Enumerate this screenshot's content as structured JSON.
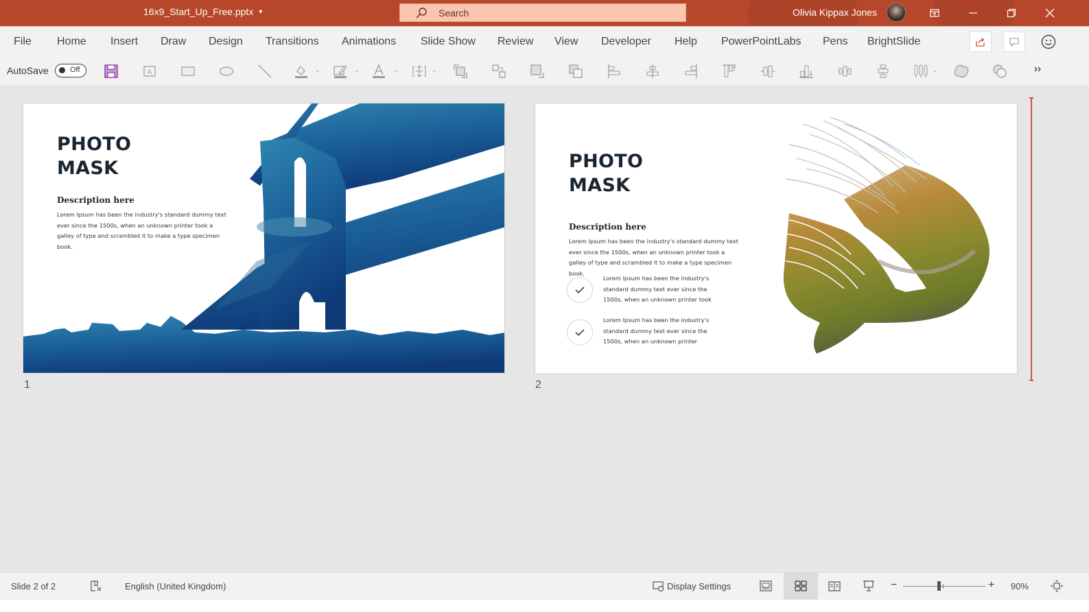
{
  "window": {
    "document_title": "16x9_Start_Up_Free.pptx",
    "search_placeholder": "Search",
    "user_name": "Olivia Kippax Jones",
    "accent_color": "#b7472a"
  },
  "ribbon_tabs": [
    {
      "label": "File"
    },
    {
      "label": "Home"
    },
    {
      "label": "Insert"
    },
    {
      "label": "Draw"
    },
    {
      "label": "Design"
    },
    {
      "label": "Transitions"
    },
    {
      "label": "Animations"
    },
    {
      "label": "Slide Show"
    },
    {
      "label": "Review"
    },
    {
      "label": "View"
    },
    {
      "label": "Developer"
    },
    {
      "label": "Help"
    },
    {
      "label": "PowerPointLabs"
    },
    {
      "label": "Pens"
    },
    {
      "label": "BrightSlide"
    }
  ],
  "toolbar": {
    "autosave_label": "AutoSave",
    "autosave_state": "Off",
    "icons": [
      "save-icon",
      "text-box-icon",
      "rectangle-icon",
      "oval-icon",
      "line-icon",
      "shape-fill-icon",
      "shape-outline-icon",
      "font-color-icon",
      "size-position-icon",
      "bring-forward-icon",
      "group-icon",
      "send-backward-icon",
      "send-to-back-icon",
      "align-left-icon",
      "align-center-icon",
      "align-right-icon",
      "align-top-icon",
      "align-middle-icon",
      "align-bottom-icon",
      "distribute-horizontally-icon",
      "distribute-vertically-icon",
      "columns-icon",
      "merge-shapes-union-icon",
      "merge-shapes-combine-icon",
      "more-icon"
    ]
  },
  "slides": [
    {
      "number": "1",
      "title_line1": "PHOTO",
      "title_line2": "MASK",
      "subtitle": "Description here",
      "body": "Lorem Ipsum has been the industry's standard dummy text ever since the 1500s, when an unknown printer took a galley of type and scrambled it to make a type specimen book."
    },
    {
      "number": "2",
      "title_line1": "PHOTO",
      "title_line2": "MASK",
      "subtitle": "Description here",
      "body": "Lorem Ipsum has been the industry's standard dummy text ever since the 1500s, when an unknown printer took a galley of type and scrambled it to make a type specimen book.",
      "bullets": [
        "Lorem Ipsum has been the industry's standard dummy text ever since the 1500s, when an unknown printer took",
        "Lorem Ipsum has been the industry's standard dummy text ever since the 1500s, when an unknown printer"
      ]
    }
  ],
  "statusbar": {
    "slide_position": "Slide 2 of 2",
    "language": "English (United Kingdom)",
    "display_settings": "Display Settings",
    "zoom_minus": "−",
    "zoom_plus": "+",
    "zoom_level": "90%"
  }
}
